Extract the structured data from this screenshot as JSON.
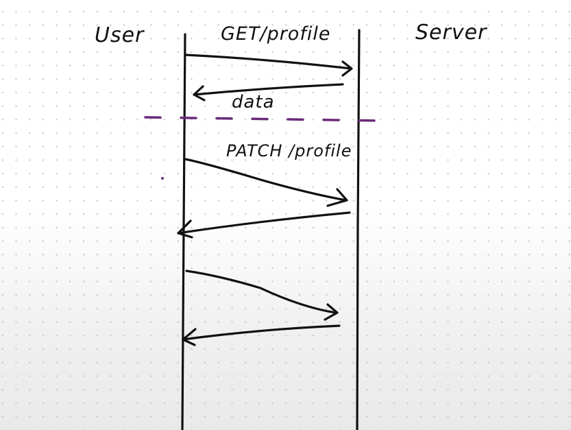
{
  "diagram": {
    "participants": [
      {
        "label": "User"
      },
      {
        "label": "Server"
      }
    ],
    "messages": [
      {
        "label": "GET/profile",
        "direction": "User→Server"
      },
      {
        "label": "data",
        "direction": "Server→User"
      },
      {
        "label": "PATCH /profile",
        "direction": "User→Server"
      },
      {
        "label": "",
        "direction": "Server→User"
      },
      {
        "label": "",
        "direction": "User→Server"
      },
      {
        "label": "",
        "direction": "Server→User"
      }
    ],
    "separator_color": "#6a2a7a",
    "ink_color": "#111111"
  }
}
